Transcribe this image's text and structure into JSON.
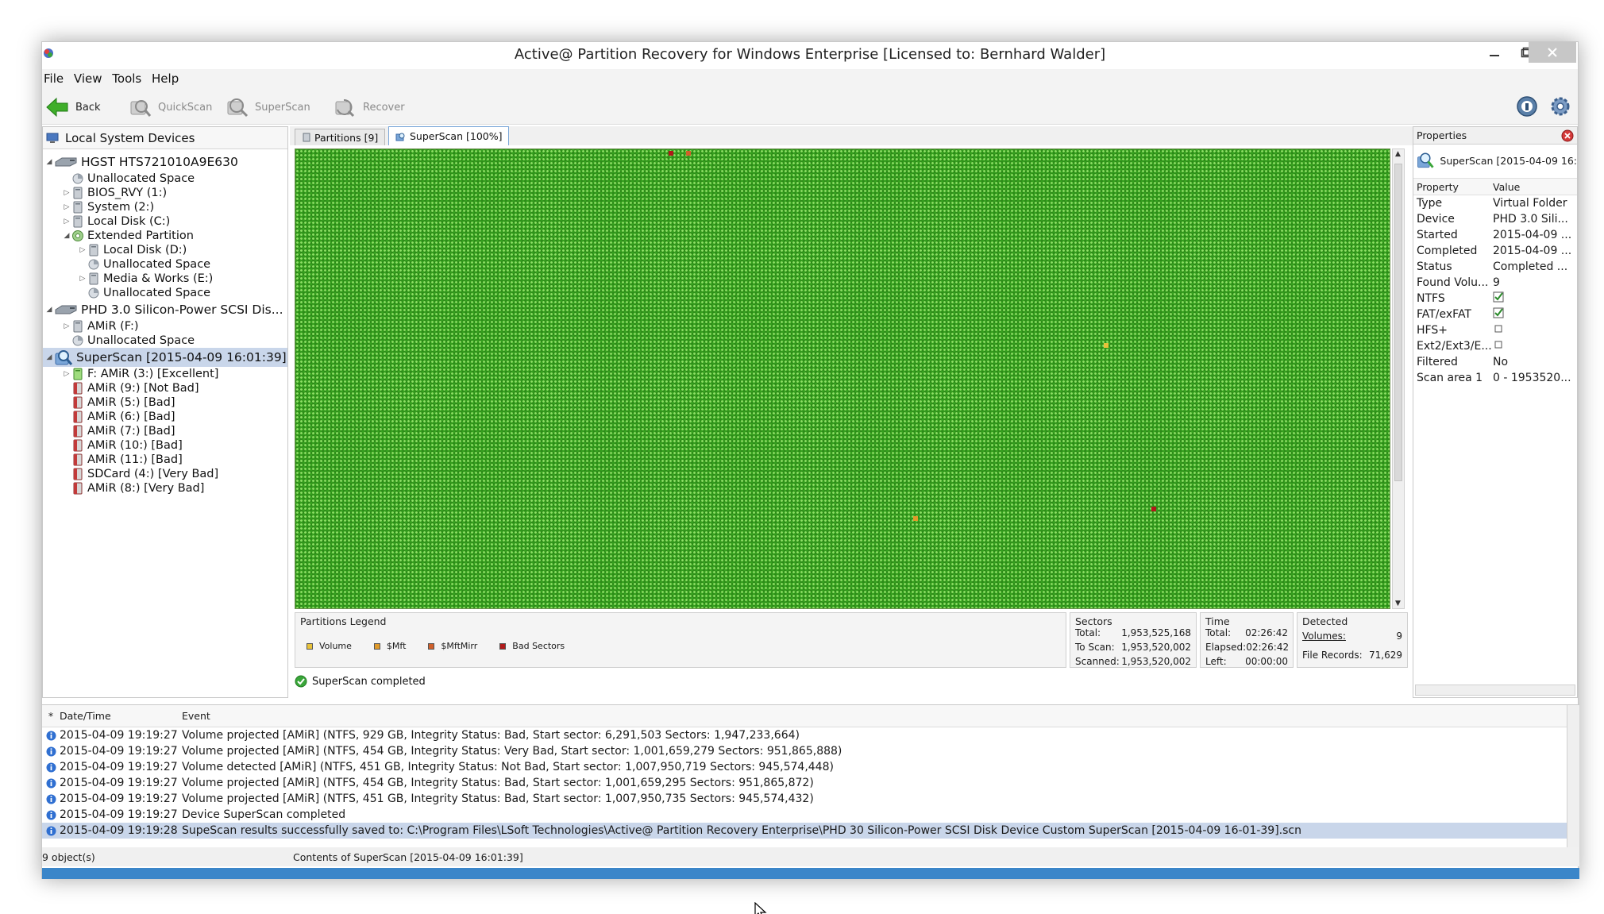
{
  "window": {
    "title": "Active@ Partition Recovery for Windows Enterprise [Licensed to: Bernhard Walder]"
  },
  "menu": [
    "File",
    "View",
    "Tools",
    "Help"
  ],
  "toolbar": {
    "back": "Back",
    "quickscan": "QuickScan",
    "superscan": "SuperScan",
    "recover": "Recover"
  },
  "tree": {
    "header": "Local System Devices",
    "rows": [
      {
        "label": "HGST HTS721010A9E630"
      },
      {
        "label": "Unallocated Space"
      },
      {
        "label": "BIOS_RVY (1:)"
      },
      {
        "label": "System (2:)"
      },
      {
        "label": "Local Disk (C:)"
      },
      {
        "label": "Extended Partition"
      },
      {
        "label": "Local Disk (D:)"
      },
      {
        "label": "Unallocated Space"
      },
      {
        "label": "Media & Works (E:)"
      },
      {
        "label": "Unallocated Space"
      },
      {
        "label": "PHD 3.0 Silicon-Power SCSI Dis..."
      },
      {
        "label": "AMiR (F:)"
      },
      {
        "label": "Unallocated Space"
      },
      {
        "label": "SuperScan [2015-04-09 16:01:39]"
      },
      {
        "label": "F: AMiR (3:) [Excellent]"
      },
      {
        "label": "AMiR (9:) [Not Bad]"
      },
      {
        "label": "AMiR (5:) [Bad]"
      },
      {
        "label": "AMiR (6:) [Bad]"
      },
      {
        "label": "AMiR (7:) [Bad]"
      },
      {
        "label": "AMiR (10:) [Bad]"
      },
      {
        "label": "AMiR (11:) [Bad]"
      },
      {
        "label": "SDCard (4:) [Very Bad]"
      },
      {
        "label": "AMiR (8:) [Very Bad]"
      }
    ]
  },
  "tabs": [
    {
      "label": "Partitions [9]"
    },
    {
      "label": "SuperScan [100%]"
    }
  ],
  "legend": {
    "title": "Partitions Legend",
    "items": [
      {
        "label": "Volume",
        "color": "#e8c23a"
      },
      {
        "label": "$Mft",
        "color": "#e09a2a"
      },
      {
        "label": "$MftMirr",
        "color": "#d0602a"
      },
      {
        "label": "Bad Sectors",
        "color": "#b01a1a"
      }
    ]
  },
  "sectors": {
    "title": "Sectors",
    "rows": [
      {
        "label": "Total:",
        "value": "1,953,525,168"
      },
      {
        "label": "To Scan:",
        "value": "1,953,520,002"
      },
      {
        "label": "Scanned:",
        "value": "1,953,520,002"
      }
    ]
  },
  "time": {
    "title": "Time",
    "rows": [
      {
        "label": "Total:",
        "value": "02:26:42"
      },
      {
        "label": "Elapsed:",
        "value": "02:26:42"
      },
      {
        "label": "Left:",
        "value": "00:00:00"
      }
    ]
  },
  "detected": {
    "title": "Detected",
    "rows": [
      {
        "label": "Volumes:",
        "value": "9"
      },
      {
        "label": "File Records:",
        "value": "71,629"
      }
    ]
  },
  "status_line": "SuperScan completed",
  "properties": {
    "title": "Properties",
    "object": "SuperScan [2015-04-09 16:",
    "col_property": "Property",
    "col_value": "Value",
    "rows": [
      {
        "name": "Type",
        "value": "Virtual Folder"
      },
      {
        "name": "Device",
        "value": "PHD 3.0 Sili..."
      },
      {
        "name": "Started",
        "value": "2015-04-09 ..."
      },
      {
        "name": "Completed",
        "value": "2015-04-09 ..."
      },
      {
        "name": "Status",
        "value": "Completed ..."
      },
      {
        "name": "Found Volu...",
        "value": "9"
      },
      {
        "name": "NTFS",
        "value": ""
      },
      {
        "name": "FAT/exFAT",
        "value": ""
      },
      {
        "name": "HFS+",
        "value": ""
      },
      {
        "name": "Ext2/Ext3/E...",
        "value": ""
      },
      {
        "name": "Filtered",
        "value": "No"
      },
      {
        "name": "Scan area 1",
        "value": "0 - 1953520..."
      }
    ]
  },
  "log": {
    "col_marker": "*",
    "col_datetime": "Date/Time",
    "col_event": "Event",
    "rows": [
      {
        "datetime": "2015-04-09 19:19:27",
        "event": "Volume projected [AMiR] (NTFS, 929 GB, Integrity Status: Bad, Start sector: 6,291,503 Sectors: 1,947,233,664)"
      },
      {
        "datetime": "2015-04-09 19:19:27",
        "event": "Volume projected [AMiR] (NTFS, 454 GB, Integrity Status: Very Bad, Start sector: 1,001,659,279 Sectors: 951,865,888)"
      },
      {
        "datetime": "2015-04-09 19:19:27",
        "event": "Volume detected [AMiR] (NTFS, 451 GB, Integrity Status: Not Bad, Start sector: 1,007,950,719 Sectors: 945,574,448)"
      },
      {
        "datetime": "2015-04-09 19:19:27",
        "event": "Volume projected [AMiR] (NTFS, 454 GB, Integrity Status: Bad, Start sector: 1,001,659,295 Sectors: 951,865,872)"
      },
      {
        "datetime": "2015-04-09 19:19:27",
        "event": "Volume projected [AMiR] (NTFS, 451 GB, Integrity Status: Bad, Start sector: 1,007,950,735 Sectors: 945,574,432)"
      },
      {
        "datetime": "2015-04-09 19:19:27",
        "event": "Device SuperScan completed"
      },
      {
        "datetime": "2015-04-09 19:19:28",
        "event": "SupeScan results successfully saved to: C:\\Program Files\\LSoft Technologies\\Active@ Partition Recovery Enterprise\\PHD 30 Silicon-Power SCSI Disk Device Custom SuperScan [2015-04-09 16-01-39].scn"
      }
    ]
  },
  "statusbar": {
    "objects": "9 object(s)",
    "contents": "Contents of SuperScan [2015-04-09 16:01:39]"
  }
}
